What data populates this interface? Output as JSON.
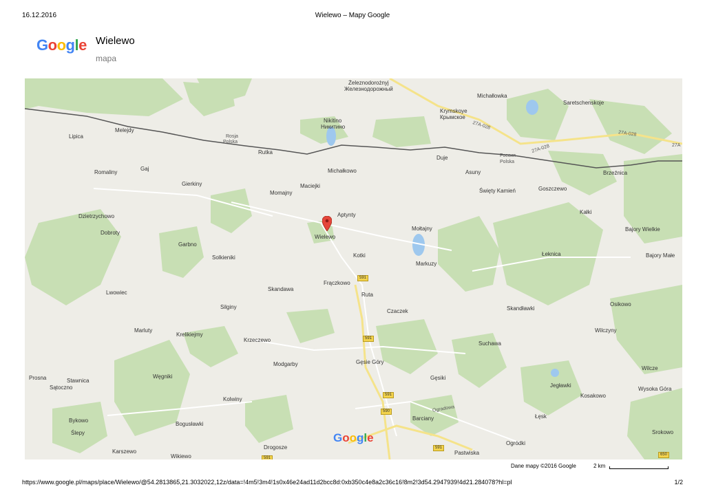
{
  "header": {
    "date": "16.12.2016",
    "title": "Wielewo – Mapy Google"
  },
  "logo": {
    "text": "Google",
    "colors": [
      "#4285F4",
      "#EA4335",
      "#FBBC05",
      "#4285F4",
      "#34A853",
      "#EA4335"
    ]
  },
  "place": {
    "name": "Wielewo",
    "type": "mapa"
  },
  "map": {
    "map_logo": "Google",
    "attribution": "Dane mapy ©2016 Google",
    "scale_label": "2 km",
    "marker_icon": "map-pin-icon",
    "colors": {
      "land": "#eeede7",
      "forest": "#c8dfb4",
      "water": "#9ec8ee",
      "road_major": "#f5e38a",
      "border": "#555555"
    },
    "labels": [
      {
        "id": "zheleznodorozhny-pl",
        "text": "Żeleznodorożnyj"
      },
      {
        "id": "zheleznodorozhny-ru",
        "text": "Железнодорожный"
      },
      {
        "id": "michalowka",
        "text": "Michałlowka"
      },
      {
        "id": "saretschenskoje",
        "text": "Saretschenskoje"
      },
      {
        "id": "krymskoye",
        "text": "Krymskoye"
      },
      {
        "id": "krymskoye-ru",
        "text": "Крымское"
      },
      {
        "id": "nikitino",
        "text": "Nikitino"
      },
      {
        "id": "nikitino-ru",
        "text": "Никитино"
      },
      {
        "id": "lipica",
        "text": "Lipica"
      },
      {
        "id": "melejdy",
        "text": "Melejdy"
      },
      {
        "id": "rutka",
        "text": "Rutka"
      },
      {
        "id": "duje",
        "text": "Duje"
      },
      {
        "id": "rossija",
        "text": "Россия"
      },
      {
        "id": "polska-right",
        "text": "Polska"
      },
      {
        "id": "rosja",
        "text": "Rosja"
      },
      {
        "id": "polska-left",
        "text": "Polska"
      },
      {
        "id": "romaliny",
        "text": "Romaliny"
      },
      {
        "id": "gaj",
        "text": "Gaj"
      },
      {
        "id": "michalkowo",
        "text": "Michałkowo"
      },
      {
        "id": "asuny",
        "text": "Asuny"
      },
      {
        "id": "brzeznica",
        "text": "Brzeźnica"
      },
      {
        "id": "gierkiny",
        "text": "Gierkiny"
      },
      {
        "id": "maciejki",
        "text": "Maciejki"
      },
      {
        "id": "momajny",
        "text": "Momajny"
      },
      {
        "id": "swiety-kamien",
        "text": "Święty Kamień"
      },
      {
        "id": "goszczewo",
        "text": "Goszczewo"
      },
      {
        "id": "kalki",
        "text": "Kałki"
      },
      {
        "id": "dzietrzychowo",
        "text": "Dzietrzychowo"
      },
      {
        "id": "aptynty",
        "text": "Aptynty"
      },
      {
        "id": "moltajny",
        "text": "Mołtajny"
      },
      {
        "id": "bajory-wielkie",
        "text": "Bajory Wielkie"
      },
      {
        "id": "dobroty",
        "text": "Dobroty"
      },
      {
        "id": "wielewo",
        "text": "Wielewo"
      },
      {
        "id": "garbno",
        "text": "Garbno"
      },
      {
        "id": "solkieniki",
        "text": "Solkieniki"
      },
      {
        "id": "kotki",
        "text": "Kotki"
      },
      {
        "id": "leknica",
        "text": "Łeknica"
      },
      {
        "id": "bajory-male",
        "text": "Bajory Małe"
      },
      {
        "id": "markuzy",
        "text": "Markuzy"
      },
      {
        "id": "fraczkowo",
        "text": "Frączkowo"
      },
      {
        "id": "skandawa",
        "text": "Skandawa"
      },
      {
        "id": "lwowiec",
        "text": "Lwowiec"
      },
      {
        "id": "ruta",
        "text": "Ruta"
      },
      {
        "id": "osikowo",
        "text": "Osikowo"
      },
      {
        "id": "silginy",
        "text": "Silginy"
      },
      {
        "id": "czaczek",
        "text": "Czaczek"
      },
      {
        "id": "skandlawki",
        "text": "Skandławki"
      },
      {
        "id": "marluty",
        "text": "Marluty"
      },
      {
        "id": "krelikiejmy",
        "text": "Krelikiejmy"
      },
      {
        "id": "wilczyny",
        "text": "Wilczyny"
      },
      {
        "id": "krzeczewo",
        "text": "Krzeczewo"
      },
      {
        "id": "suchawa",
        "text": "Suchawa"
      },
      {
        "id": "modgarby",
        "text": "Modgarby"
      },
      {
        "id": "gesie-gory",
        "text": "Gęsie Góry"
      },
      {
        "id": "wilcze",
        "text": "Wilcze"
      },
      {
        "id": "prosna",
        "text": "Prosna"
      },
      {
        "id": "wegniki",
        "text": "Węgniki"
      },
      {
        "id": "gesiki",
        "text": "Gęsiki"
      },
      {
        "id": "jeglawki",
        "text": "Jegławki"
      },
      {
        "id": "stawnica",
        "text": "Stawnica"
      },
      {
        "id": "satoczno",
        "text": "Sątoczno"
      },
      {
        "id": "wysoka-gora",
        "text": "Wysoka Góra"
      },
      {
        "id": "kolwiny",
        "text": "Kolwiny"
      },
      {
        "id": "kosakowo",
        "text": "Kosakowo"
      },
      {
        "id": "bykowo",
        "text": "Bykowo"
      },
      {
        "id": "boguslawki",
        "text": "Bogusławki"
      },
      {
        "id": "barciany",
        "text": "Barciany"
      },
      {
        "id": "lesk",
        "text": "Łęsk"
      },
      {
        "id": "slepy",
        "text": "Ślepy"
      },
      {
        "id": "srokowo",
        "text": "Srokowo"
      },
      {
        "id": "ogrodki",
        "text": "Ogródki"
      },
      {
        "id": "karszewo",
        "text": "Karszewo"
      },
      {
        "id": "drogosze",
        "text": "Drogosze"
      },
      {
        "id": "pastwiska",
        "text": "Pastwiska"
      },
      {
        "id": "wikiewo",
        "text": "Wikiewo"
      },
      {
        "id": "ogradowa",
        "text": "Ogradowa"
      }
    ],
    "road_shields": [
      {
        "id": "r591-a",
        "text": "591"
      },
      {
        "id": "r591-b",
        "text": "591"
      },
      {
        "id": "r591-c",
        "text": "591"
      },
      {
        "id": "r590",
        "text": "590"
      },
      {
        "id": "r591-d",
        "text": "591"
      },
      {
        "id": "r591-e",
        "text": "591"
      },
      {
        "id": "r650",
        "text": "650"
      },
      {
        "id": "r27a-1",
        "text": "27A-028"
      },
      {
        "id": "r27a-2",
        "text": "27A-028"
      },
      {
        "id": "r27a-3",
        "text": "27A-028"
      },
      {
        "id": "r27a-4",
        "text": "27A"
      }
    ]
  },
  "footer": {
    "url": "https://www.google.pl/maps/place/Wielewo/@54.2813865,21.3032022,12z/data=!4m5!3m4!1s0x46e24ad11d2bcc8d:0xb350c4e8a2c36c16!8m2!3d54.2947939!4d21.284078?hl=pl",
    "page": "1/2"
  }
}
